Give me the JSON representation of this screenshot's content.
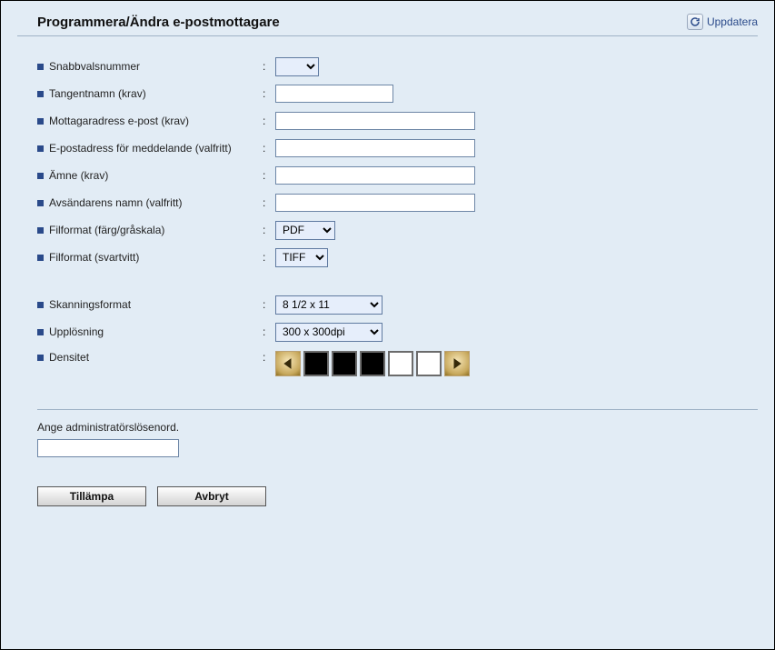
{
  "header": {
    "title": "Programmera/Ändra e-postmottagare",
    "update_label": "Uppdatera"
  },
  "labels": {
    "speed_dial": "Snabbvalsnummer",
    "key_name": "Tangentnamn (krav)",
    "recipient_email": "Mottagaradress e-post (krav)",
    "notify_email": "E-postadress för meddelande (valfritt)",
    "subject": "Ämne (krav)",
    "sender_name": "Avsändarens namn (valfritt)",
    "file_format_color": "Filformat (färg/gråskala)",
    "file_format_bw": "Filformat (svartvitt)",
    "scan_format": "Skanningsformat",
    "resolution": "Upplösning",
    "density": "Densitet"
  },
  "values": {
    "speed_dial": "",
    "key_name": "",
    "recipient_email": "",
    "notify_email": "",
    "subject": "",
    "sender_name": "",
    "file_format_color": "PDF",
    "file_format_bw": "TIFF",
    "scan_format": "8 1/2 x 11",
    "resolution": "300 x 300dpi"
  },
  "admin": {
    "prompt": "Ange administratörslösenord.",
    "value": ""
  },
  "buttons": {
    "apply": "Tillämpa",
    "cancel": "Avbryt"
  }
}
